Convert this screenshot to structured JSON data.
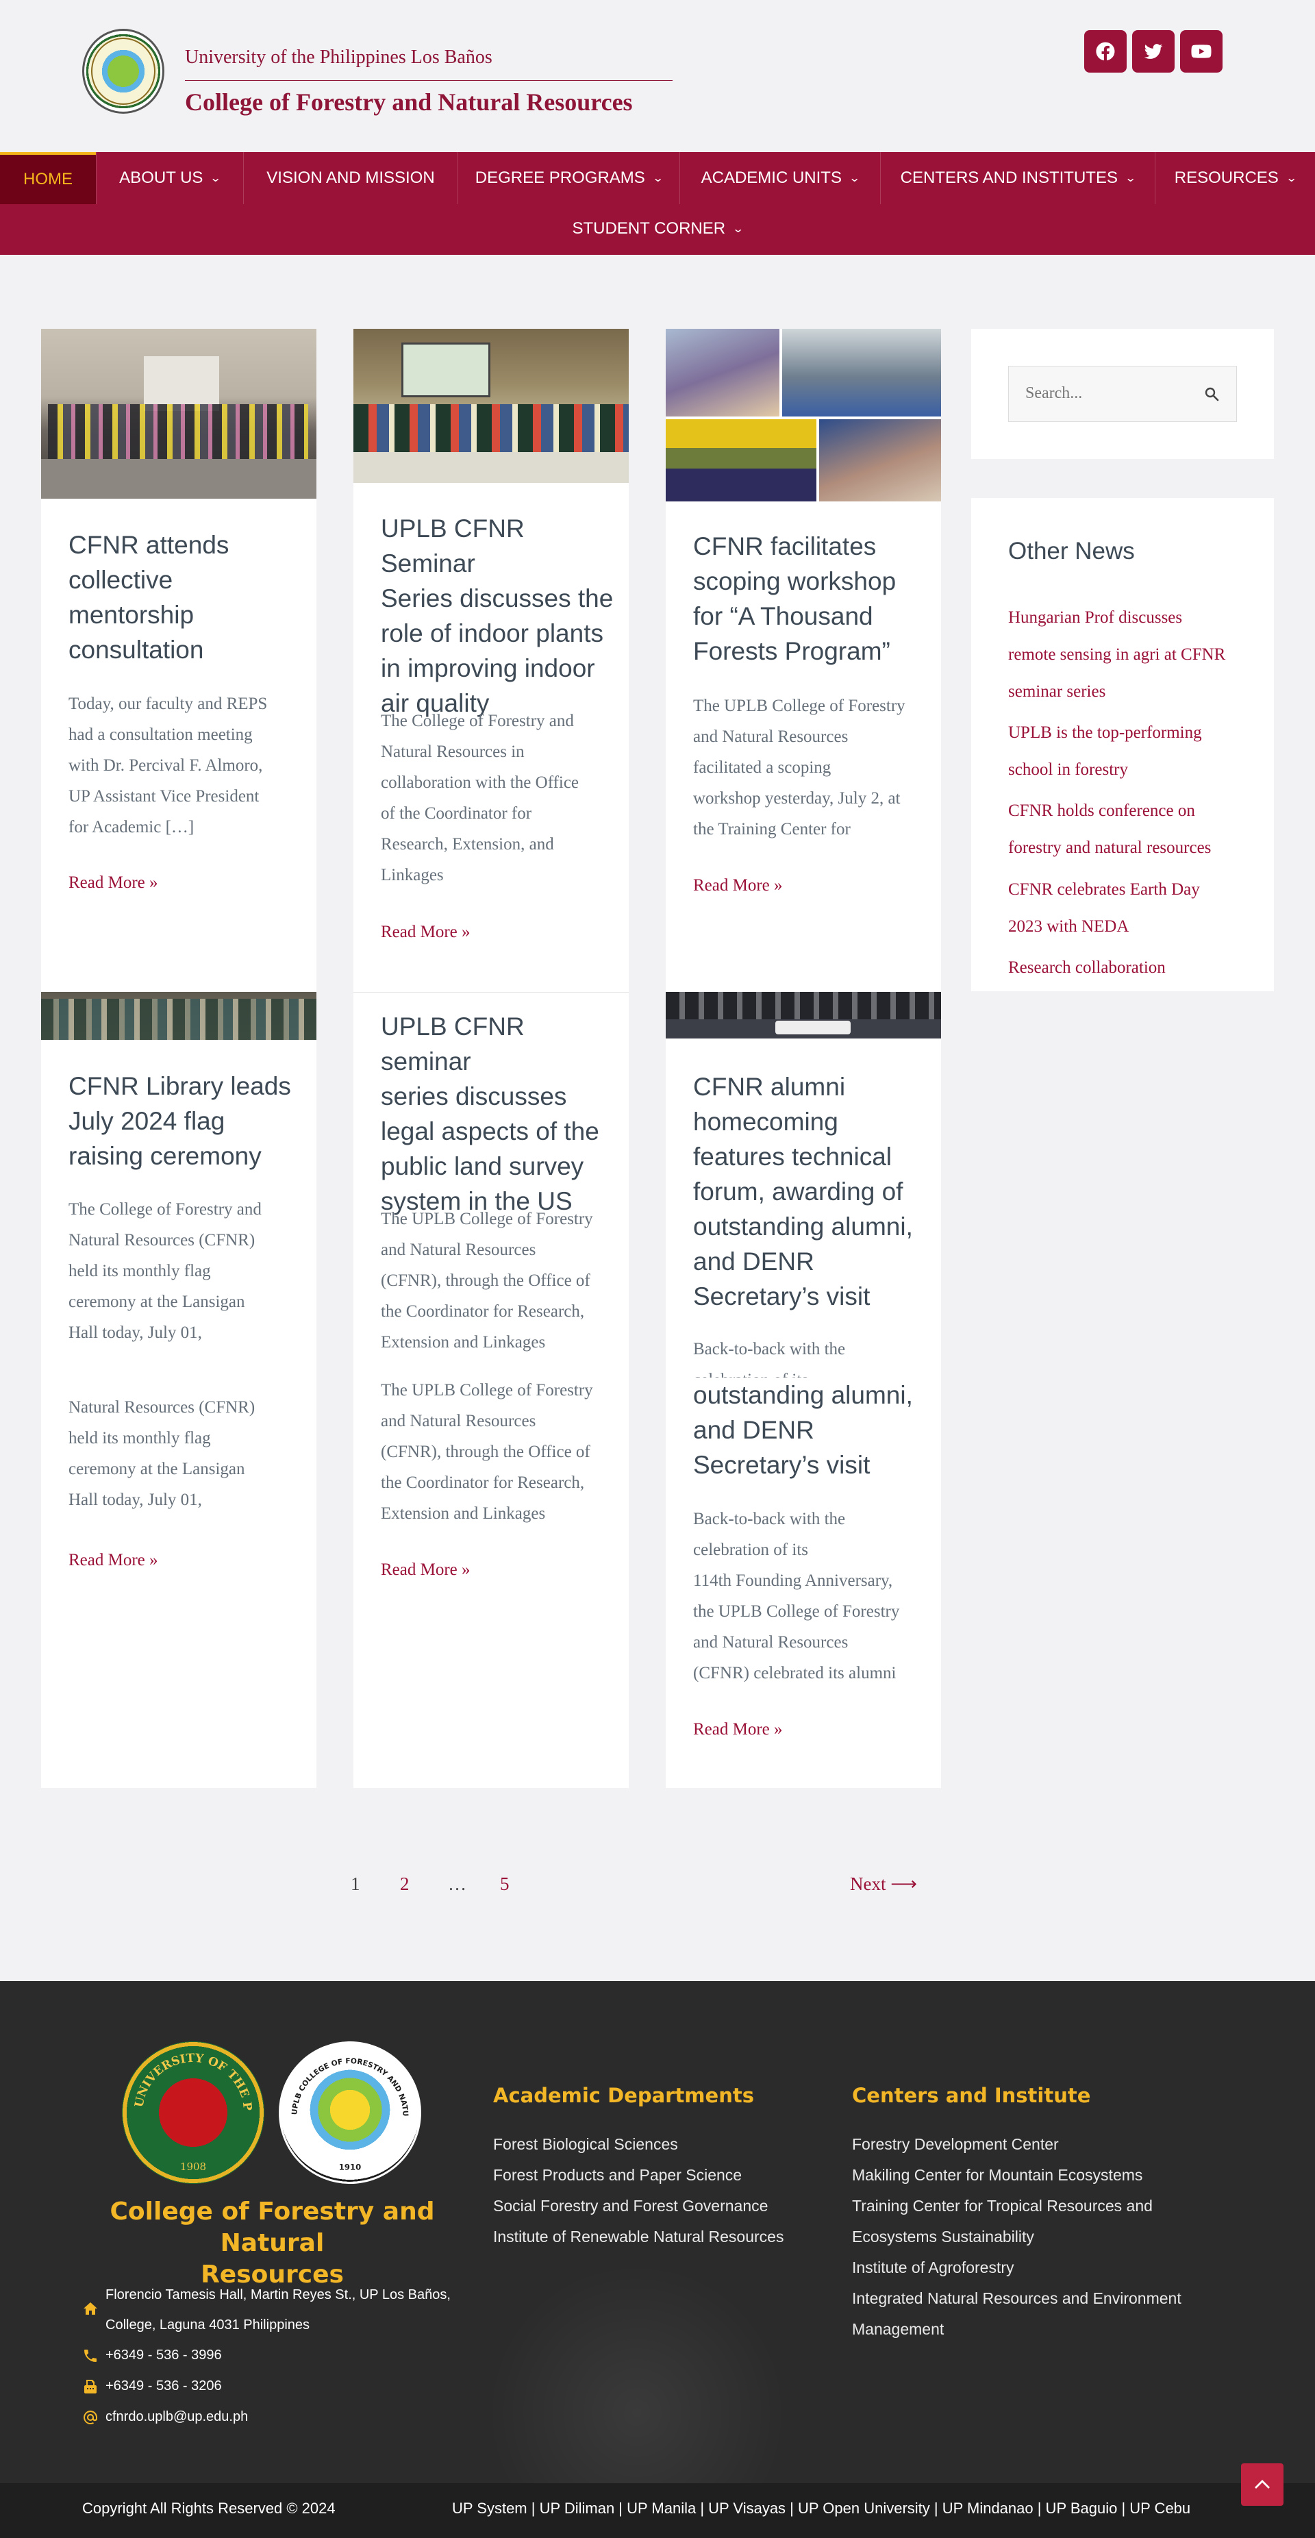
{
  "header": {
    "university": "University of the Philippines Los Baños",
    "college": "College of Forestry and Natural Resources",
    "social_icons": [
      "facebook-icon",
      "twitter-icon",
      "youtube-icon"
    ]
  },
  "nav": {
    "items": [
      {
        "label": "HOME",
        "active": true,
        "dropdown": false
      },
      {
        "label": "ABOUT US",
        "dropdown": true
      },
      {
        "label": "VISION AND MISSION",
        "dropdown": false
      },
      {
        "label": "DEGREE PROGRAMS",
        "dropdown": true
      },
      {
        "label": "ACADEMIC UNITS",
        "dropdown": true
      },
      {
        "label": "CENTERS AND INSTITUTES",
        "dropdown": true
      },
      {
        "label": "RESOURCES",
        "dropdown": true
      },
      {
        "label": "STUDENT CORNER",
        "dropdown": true
      }
    ]
  },
  "posts": [
    {
      "title_lines": [
        "CFNR attends",
        "collective",
        "mentorship",
        "consultation"
      ],
      "excerpt_lines": [
        "Today, our faculty and REPS",
        "had a consultation meeting",
        "with Dr. Percival F. Almoro,",
        "UP Assistant Vice President",
        "for Academic […]"
      ],
      "read_more": "Read More »"
    },
    {
      "title_lines": [
        "UPLB CFNR Seminar",
        "Series discusses the",
        "role of indoor plants",
        "in improving indoor",
        "air quality"
      ],
      "excerpt_lines": [
        "The College of Forestry and",
        "Natural Resources in",
        "collaboration with the Office",
        "of the Coordinator for",
        "Research, Extension, and",
        "Linkages"
      ],
      "read_more": "Read More »"
    },
    {
      "title_lines": [
        "CFNR facilitates",
        "scoping workshop",
        "for “A Thousand",
        "Forests Program”"
      ],
      "excerpt_lines": [
        "The UPLB College of Forestry",
        "and Natural Resources",
        "facilitated a scoping",
        "workshop yesterday, July 2, at",
        "the Training Center for"
      ],
      "read_more": "Read More »"
    },
    {
      "title_lines": [
        "CFNR Library leads",
        "July 2024 flag",
        "raising ceremony"
      ],
      "excerpt_lines": [
        "The College of Forestry and",
        "Natural Resources (CFNR)",
        "held its monthly flag",
        "ceremony at the Lansigan",
        "Hall today, July 01,"
      ],
      "excerpt_dup_lines": [
        "Natural Resources (CFNR)",
        "held its monthly flag",
        "ceremony at the Lansigan",
        "Hall today, July 01,"
      ],
      "read_more": "Read More »"
    },
    {
      "title_lines": [
        "UPLB CFNR seminar",
        "series discusses",
        "legal aspects of the",
        "public land survey",
        "system in the US"
      ],
      "excerpt_lines": [
        "The UPLB College of Forestry",
        "and Natural Resources",
        "(CFNR), through the Office of",
        "the Coordinator for Research,",
        "Extension and Linkages"
      ],
      "excerpt_dup_lines": [
        "The UPLB College of Forestry",
        "and Natural Resources",
        "(CFNR), through the Office of",
        "the Coordinator for Research,",
        "Extension and Linkages"
      ],
      "read_more": "Read More »"
    },
    {
      "title_lines": [
        "CFNR alumni",
        "homecoming",
        "features technical",
        "forum, awarding of",
        "outstanding alumni,",
        "and DENR",
        "Secretary’s visit"
      ],
      "excerpt_lines": [
        "Back-to-back with the",
        "celebration of its"
      ],
      "title_dup_lines": [
        "outstanding alumni,",
        "and DENR",
        "Secretary’s visit"
      ],
      "excerpt_dup_lines": [
        "Back-to-back with the",
        "celebration of its",
        "114th Founding Anniversary,",
        "the UPLB College of Forestry",
        "and Natural Resources",
        "(CFNR) celebrated its alumni"
      ],
      "read_more": "Read More »"
    }
  ],
  "sidebar": {
    "search_placeholder": "Search...",
    "other_news_title": "Other News",
    "news": [
      [
        "Hungarian Prof discusses",
        "remote sensing in agri at CFNR",
        "seminar series"
      ],
      [
        "UPLB is the top-performing",
        "school in forestry"
      ],
      [
        "CFNR holds conference on",
        "forestry and natural resources"
      ],
      [
        "CFNR celebrates Earth Day",
        "2023 with NEDA"
      ],
      [
        "Research collaboration"
      ]
    ]
  },
  "pagination": {
    "pages": [
      "1",
      "2",
      "…",
      "5"
    ],
    "next": "Next ⟶",
    "current": "1"
  },
  "footer": {
    "college_lines": [
      "College of Forestry and Natural",
      "Resources"
    ],
    "address_lines": [
      "Florencio Tamesis Hall, Martin Reyes St., UP Los Baños,",
      "College, Laguna 4031 Philippines"
    ],
    "phone": "+6349 - 536 - 3996",
    "fax": "+6349 - 536 - 3206",
    "email": "cfnrdo.uplb@up.edu.ph",
    "departments_title": "Academic Departments",
    "departments": [
      "Forest Biological Sciences",
      "Forest Products and Paper Science",
      "Social Forestry and Forest Governance",
      "Institute of Renewable Natural Resources"
    ],
    "centers_title": "Centers and Institute",
    "centers": [
      "Forestry Development Center",
      "Makiling Center for Mountain Ecosystems",
      "Training Center for Tropical Resources and",
      "Ecosystems Sustainability",
      "Institute of Agroforestry",
      "Integrated Natural Resources and Environment",
      "Management"
    ],
    "copyright": "Copyright All Rights Reserved © 2024",
    "up_links": "UP System | UP Diliman | UP Manila | UP Visayas | UP Open University | UP Mindanao | UP Baguio | UP Cebu",
    "seal_up_text": "UNIVERSITY OF THE PHILIPPINES",
    "seal_up_year": "1908",
    "seal_cfnr_text": "UPLB COLLEGE OF FORESTRY AND NATURAL RESOURCES",
    "seal_cfnr_year": "1910"
  },
  "colors": {
    "maroon": "#9b1238",
    "dark_maroon": "#6e0216",
    "gold": "#f3b626",
    "footer_bg": "#2b2b2b"
  }
}
